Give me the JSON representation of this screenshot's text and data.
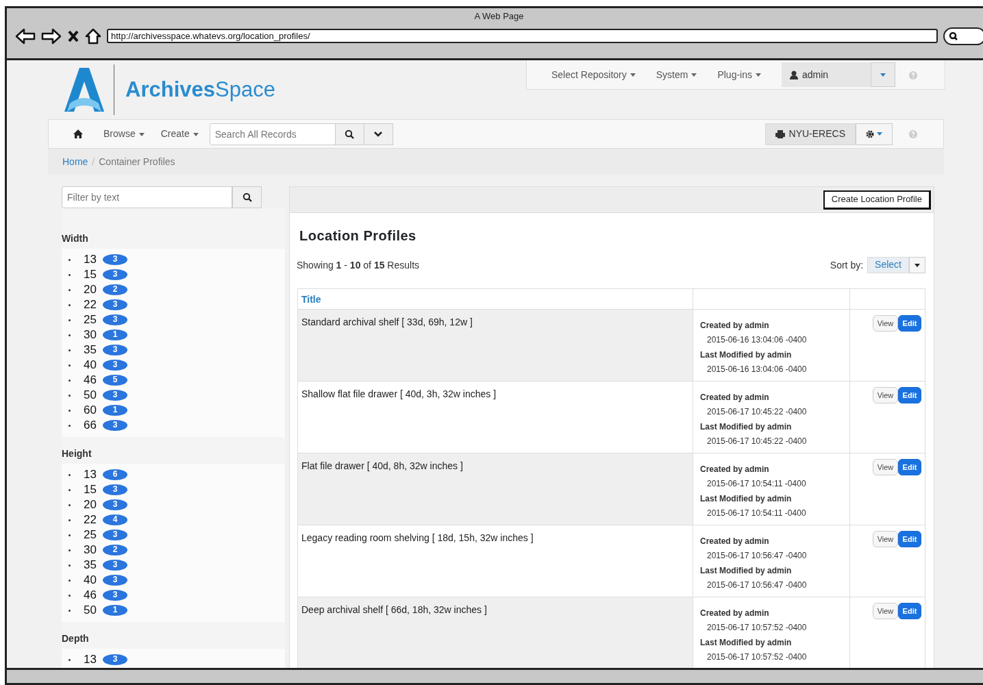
{
  "browser": {
    "title": "A Web Page",
    "url": "http://archivesspace.whatevs.org/location_profiles/"
  },
  "header": {
    "logo": "**Archives**Space"
  },
  "top_nav": {
    "items": [
      "Select Repository",
      "System",
      "Plug-ins"
    ],
    "user": "admin"
  },
  "main_nav": {
    "items": [
      "Browse",
      "Create"
    ],
    "search_placeholder": "Search All Records",
    "repository": "NYU-ERECS"
  },
  "breadcrumb": [
    "Home",
    "Container Profiles"
  ],
  "breadcrumb_separator": "/",
  "filter": {
    "placeholder": "Filter by text"
  },
  "facets": [
    {
      "title": "Width",
      "items": [
        {
          "value": "13",
          "count": "3"
        },
        {
          "value": "15",
          "count": "3"
        },
        {
          "value": "20",
          "count": "2"
        },
        {
          "value": "22",
          "count": "3"
        },
        {
          "value": "25",
          "count": "3"
        },
        {
          "value": "30",
          "count": "1"
        },
        {
          "value": "35",
          "count": "3"
        },
        {
          "value": "40",
          "count": "3"
        },
        {
          "value": "46",
          "count": "5"
        },
        {
          "value": "50",
          "count": "3"
        },
        {
          "value": "60",
          "count": "1"
        },
        {
          "value": "66",
          "count": "3"
        }
      ]
    },
    {
      "title": "Height",
      "items": [
        {
          "value": "13",
          "count": "6"
        },
        {
          "value": "15",
          "count": "3"
        },
        {
          "value": "20",
          "count": "3"
        },
        {
          "value": "22",
          "count": "4"
        },
        {
          "value": "25",
          "count": "3"
        },
        {
          "value": "30",
          "count": "2"
        },
        {
          "value": "35",
          "count": "3"
        },
        {
          "value": "40",
          "count": "3"
        },
        {
          "value": "46",
          "count": "3"
        },
        {
          "value": "50",
          "count": "1"
        }
      ]
    },
    {
      "title": "Depth",
      "items": [
        {
          "value": "13",
          "count": "3"
        }
      ]
    }
  ],
  "panel": {
    "create_button": "Create Location Profile",
    "heading": "Location Profiles",
    "showing": "Showing **1** - **10** of **15** Results",
    "sort_label": "Sort by:",
    "sort_value": "Select"
  },
  "table": {
    "columns": [
      "Title"
    ],
    "rows": [
      {
        "title": "Standard archival shelf [ 33d, 69h, 12w ]",
        "created_by": "Created by admin",
        "created": "2015-06-16 13:04:06 -0400",
        "modified_by": "Last Modified by admin",
        "modified": "2015-06-16 13:04:06 -0400",
        "view": "View",
        "edit": "Edit"
      },
      {
        "title": "Shallow flat file drawer [ 40d, 3h, 32w inches ]",
        "created_by": "Created by admin",
        "created": "2015-06-17 10:45:22 -0400",
        "modified_by": "Last Modified by admin",
        "modified": "2015-06-17 10:45:22 -0400",
        "view": "View",
        "edit": "Edit"
      },
      {
        "title": "Flat file drawer [ 40d, 8h, 32w inches ]",
        "created_by": "Created by admin",
        "created": "2015-06-17 10:54:11 -0400",
        "modified_by": "Last Modified by admin",
        "modified": "2015-06-17 10:54:11 -0400",
        "view": "View",
        "edit": "Edit"
      },
      {
        "title": "Legacy reading room shelving [ 18d, 15h, 32w inches ]",
        "created_by": "Created by admin",
        "created": "2015-06-17 10:56:47 -0400",
        "modified_by": "Last Modified by admin",
        "modified": "2015-06-17 10:56:47 -0400",
        "view": "View",
        "edit": "Edit"
      },
      {
        "title": "Deep archival shelf [ 66d, 18h, 32w inches ]",
        "created_by": "Created by admin",
        "created": "2015-06-17 10:57:52 -0400",
        "modified_by": "Last Modified by admin",
        "modified": "2015-06-17 10:57:52 -0400",
        "view": "View",
        "edit": "Edit"
      }
    ]
  }
}
